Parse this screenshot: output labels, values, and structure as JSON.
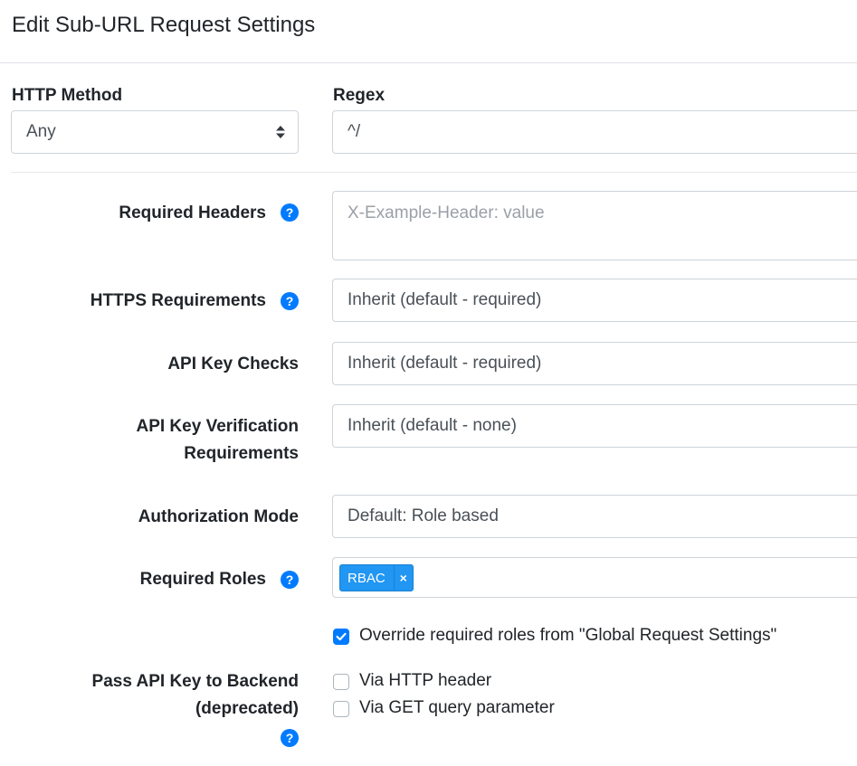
{
  "header": {
    "title": "Edit Sub-URL Request Settings"
  },
  "http_method": {
    "label": "HTTP Method",
    "value": "Any"
  },
  "regex": {
    "label": "Regex",
    "value": "^/"
  },
  "required_headers": {
    "label": "Required Headers",
    "placeholder": "X-Example-Header: value"
  },
  "https_requirements": {
    "label": "HTTPS Requirements",
    "value": "Inherit (default - required)"
  },
  "api_key_checks": {
    "label": "API Key Checks",
    "value": "Inherit (default - required)"
  },
  "api_key_verification": {
    "label_line1": "API Key Verification",
    "label_line2": "Requirements",
    "value": "Inherit (default - none)"
  },
  "authorization_mode": {
    "label": "Authorization Mode",
    "value": "Default: Role based"
  },
  "required_roles": {
    "label": "Required Roles",
    "tags": [
      "RBAC"
    ],
    "tag_remove": "×"
  },
  "override_roles": {
    "label": "Override required roles from \"Global Request Settings\"",
    "checked": true
  },
  "pass_api_key": {
    "label_line1": "Pass API Key to Backend",
    "label_line2": "(deprecated)",
    "options": [
      {
        "label": "Via HTTP header",
        "checked": false
      },
      {
        "label": "Via GET query parameter",
        "checked": false
      }
    ]
  },
  "colors": {
    "accent": "#007bff",
    "tag": "#2196f3",
    "border": "#ced4da"
  },
  "icons": {
    "help": "question-circle-icon",
    "select": "sort-arrows-icon",
    "check": "checkmark-icon"
  }
}
